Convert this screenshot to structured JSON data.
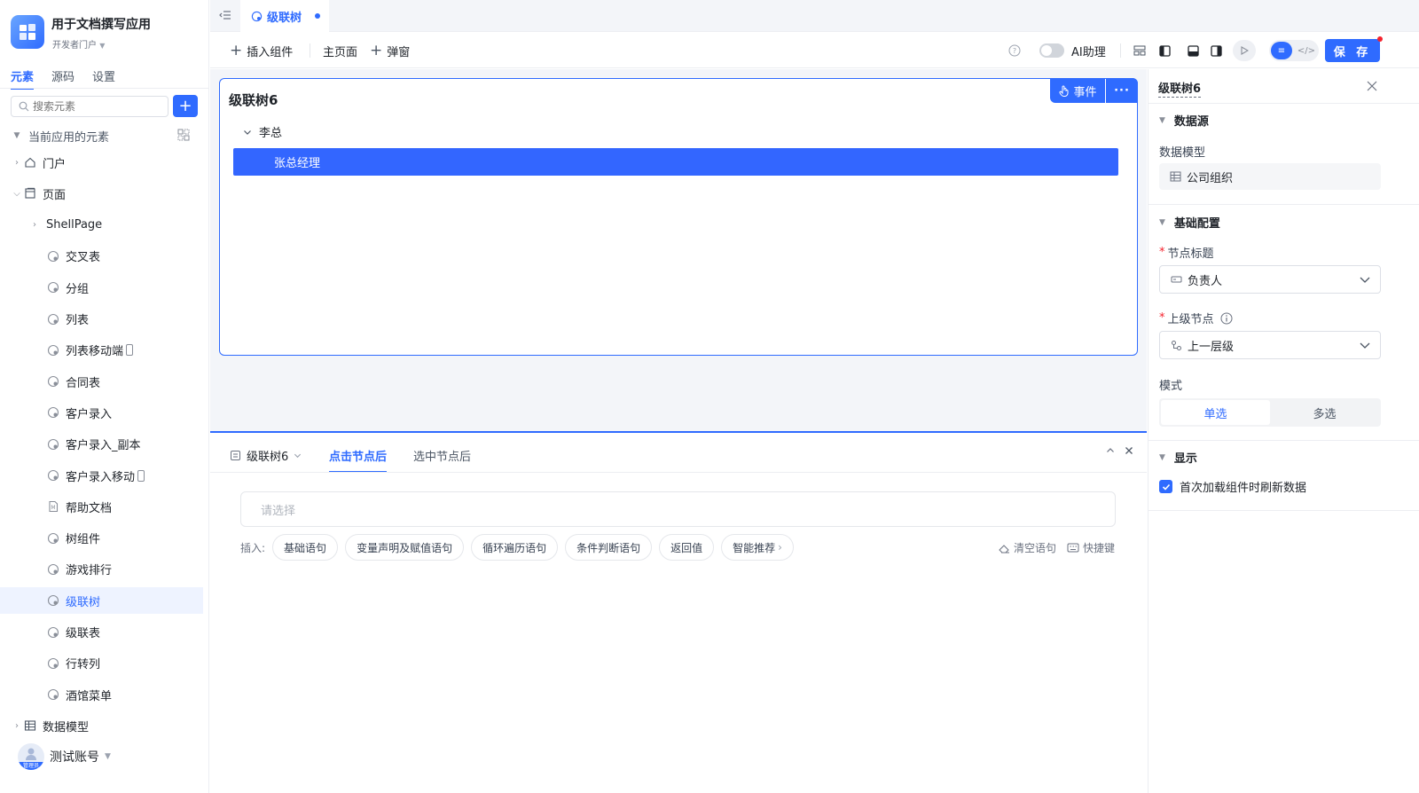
{
  "app": {
    "title": "用于文档撰写应用",
    "portal": "开发者门户"
  },
  "sidebar": {
    "tabs": [
      "元素",
      "源码",
      "设置"
    ],
    "active_tab": "元素",
    "search_placeholder": "搜索元素",
    "add_label": "+",
    "section_title": "当前应用的元素",
    "tree": [
      {
        "label": "门户",
        "level": 0,
        "icon": "home-icon",
        "expandable": true
      },
      {
        "label": "页面",
        "level": 0,
        "icon": "page-icon",
        "expandable": true
      },
      {
        "label": "ShellPage",
        "level": 1,
        "icon": "",
        "expandable": true
      },
      {
        "label": "交叉表",
        "level": 2,
        "icon": "component-icon"
      },
      {
        "label": "分组",
        "level": 2,
        "icon": "component-icon"
      },
      {
        "label": "列表",
        "level": 2,
        "icon": "component-icon"
      },
      {
        "label": "列表移动端",
        "level": 2,
        "icon": "component-icon",
        "mobile": true
      },
      {
        "label": "合同表",
        "level": 2,
        "icon": "component-icon"
      },
      {
        "label": "客户录入",
        "level": 2,
        "icon": "component-icon"
      },
      {
        "label": "客户录入_副本",
        "level": 2,
        "icon": "component-icon"
      },
      {
        "label": "客户录入移动",
        "level": 2,
        "icon": "component-icon",
        "mobile": true
      },
      {
        "label": "帮助文档",
        "level": 2,
        "icon": "document-icon"
      },
      {
        "label": "树组件",
        "level": 2,
        "icon": "component-icon"
      },
      {
        "label": "游戏排行",
        "level": 2,
        "icon": "component-icon"
      },
      {
        "label": "级联树",
        "level": 2,
        "icon": "component-icon",
        "active": true
      },
      {
        "label": "级联表",
        "level": 2,
        "icon": "component-icon"
      },
      {
        "label": "行转列",
        "level": 2,
        "icon": "component-icon"
      },
      {
        "label": "酒馆菜单",
        "level": 2,
        "icon": "component-icon"
      },
      {
        "label": "数据模型",
        "level": 0,
        "icon": "table-icon",
        "expandable": true
      }
    ],
    "user": {
      "name": "测试账号",
      "role": "管理员"
    }
  },
  "tabbar": {
    "tab_label": "级联树"
  },
  "toolbar": {
    "insert_component": "插入组件",
    "main_page": "主页面",
    "popup": "弹窗",
    "ai_assistant": "AI助理",
    "save": "保 存",
    "ai_enabled": false
  },
  "canvas": {
    "component_title": "级联树6",
    "event_label": "事件",
    "root_node": "李总",
    "child_node": "张总经理"
  },
  "bottom_panel": {
    "component": "级联树6",
    "tabs": [
      "点击节点后",
      "选中节点后"
    ],
    "active_tab": "点击节点后",
    "select_placeholder": "请选择",
    "insert_label": "插入:",
    "chips": [
      "基础语句",
      "变量声明及赋值语句",
      "循环遍历语句",
      "条件判断语句",
      "返回值",
      "智能推荐"
    ],
    "clear": "清空语句",
    "shortcuts": "快捷键"
  },
  "right_panel": {
    "title": "级联树6",
    "datasource_section": "数据源",
    "data_model_label": "数据模型",
    "data_model_value": "公司组织",
    "basic_section": "基础配置",
    "node_title_label": "节点标题",
    "node_title_value": "负责人",
    "parent_node_label": "上级节点",
    "parent_node_value": "上一层级",
    "mode_label": "模式",
    "mode_options": [
      "单选",
      "多选"
    ],
    "mode_selected": "单选",
    "display_section": "显示",
    "refresh_on_load": "首次加载组件时刷新数据",
    "refresh_checked": true
  },
  "colors": {
    "accent": "#2f6bff",
    "selected_node": "#3366ff",
    "danger": "#f5222d"
  }
}
